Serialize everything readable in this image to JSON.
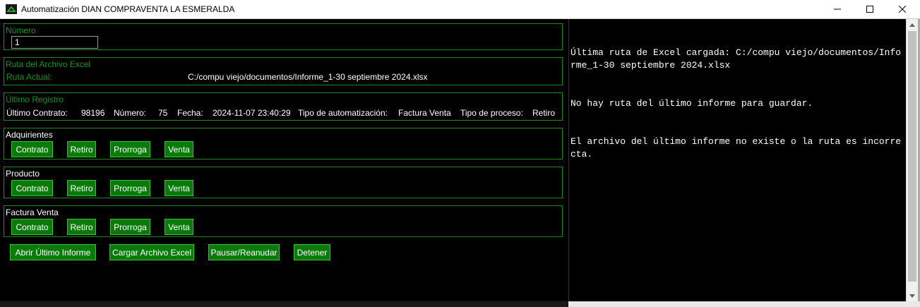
{
  "window": {
    "title": "Automatización DIAN COMPRAVENTA LA ESMERALDA"
  },
  "numero": {
    "label": "Número",
    "value": "1"
  },
  "ruta": {
    "group_label": "Ruta del Archivo Excel",
    "label": "Ruta Actual:",
    "value": "C:/compu viejo/documentos/Informe_1-30 septiembre 2024.xlsx"
  },
  "registro": {
    "group_label": "Último Registro",
    "contrato_label": "Último Contrato:",
    "contrato_value": "98196",
    "numero_label": "Número:",
    "numero_value": "75",
    "fecha_label": "Fecha:",
    "fecha_value": "2024-11-07 23:40:29",
    "tipo_auto_label": "Tipo de automatización:",
    "tipo_auto_value": "Factura Venta",
    "tipo_proc_label": "Tipo de proceso:",
    "tipo_proc_value": "Retiro"
  },
  "sections": [
    {
      "label": "Adquirientes",
      "buttons": [
        "Contrato",
        "Retiro",
        "Prorroga",
        "Venta"
      ]
    },
    {
      "label": "Producto",
      "buttons": [
        "Contrato",
        "Retiro",
        "Prorroga",
        "Venta"
      ]
    },
    {
      "label": "Factura Venta",
      "buttons": [
        "Contrato",
        "Retiro",
        "Prorroga",
        "Venta"
      ]
    }
  ],
  "actions": {
    "abrir": "Abrir Último Informe",
    "cargar": "Cargar Archivo Excel",
    "pausar": "Pausar/Reanudar",
    "detener": "Detener"
  },
  "console": {
    "lines": [
      "Última ruta de Excel cargada: C:/compu viejo/documentos/Informe_1-30 septiembre 2024.xlsx",
      "No hay ruta del último informe para guardar.",
      "El archivo del último informe no existe o la ruta es incorrecta."
    ]
  },
  "colors": {
    "accent_green": "#0a7a0a",
    "label_green": "#1f8f1f",
    "background": "#000000"
  }
}
